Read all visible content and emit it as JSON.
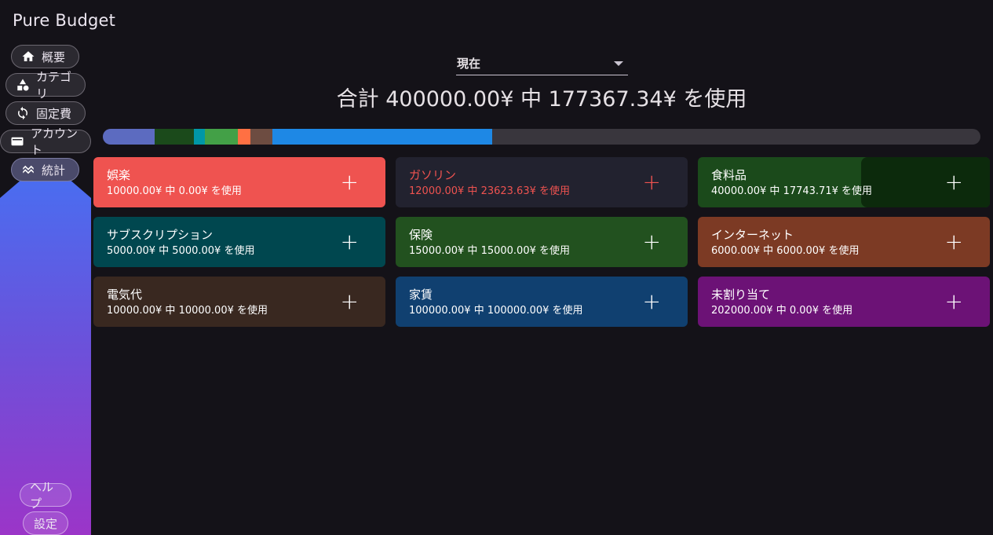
{
  "app": {
    "title": "Pure Budget"
  },
  "nav": {
    "overview": "概要",
    "categories": "カテゴリ",
    "fixed": "固定費",
    "accounts": "アカウント",
    "stats": "統計",
    "help": "ヘルプ",
    "settings": "設定"
  },
  "header": {
    "period": "現在",
    "total": "合計 400000.00¥ 中 177367.34¥ を使用"
  },
  "colors": {
    "background": "#141218",
    "card_red": "#ef5350",
    "card_navy": "#22222f",
    "card_green": "#1b4a1b",
    "card_teal": "#00474f",
    "card_forest": "#22511f",
    "card_rust": "#7c3a24",
    "card_brown": "#392820",
    "card_blue": "#104070",
    "card_purple": "#6c1276"
  },
  "progress": {
    "segments": [
      {
        "color": "#5c6bc0",
        "fraction": 0.0591
      },
      {
        "color": "#1b4a1b",
        "fraction": 0.0444
      },
      {
        "color": "#0097a7",
        "fraction": 0.0125
      },
      {
        "color": "#43a047",
        "fraction": 0.0375
      },
      {
        "color": "#ff7043",
        "fraction": 0.015
      },
      {
        "color": "#6d4c41",
        "fraction": 0.025
      },
      {
        "color": "#1e88e5",
        "fraction": 0.25
      }
    ]
  },
  "categories": [
    {
      "name": "娯楽",
      "amount": "10000.00¥ 中 0.00¥ を使用"
    },
    {
      "name": "ガソリン",
      "amount": "12000.00¥ 中 23623.63¥ を使用"
    },
    {
      "name": "食料品",
      "amount": "40000.00¥ 中 17743.71¥ を使用"
    },
    {
      "name": "サブスクリプション",
      "amount": "5000.00¥ 中 5000.00¥ を使用"
    },
    {
      "name": "保険",
      "amount": "15000.00¥ 中 15000.00¥ を使用"
    },
    {
      "name": "インターネット",
      "amount": "6000.00¥ 中 6000.00¥ を使用"
    },
    {
      "name": "電気代",
      "amount": "10000.00¥ 中 10000.00¥ を使用"
    },
    {
      "name": "家賃",
      "amount": "100000.00¥ 中 100000.00¥ を使用"
    },
    {
      "name": "未割り当て",
      "amount": "202000.00¥ 中 0.00¥ を使用"
    }
  ],
  "icons": {
    "overview": "home-icon",
    "categories": "shapes-icon",
    "fixed": "sync-icon",
    "accounts": "wallet-icon",
    "stats": "trending-icon",
    "add": "plus-icon",
    "dropdown": "caret-down-icon"
  }
}
